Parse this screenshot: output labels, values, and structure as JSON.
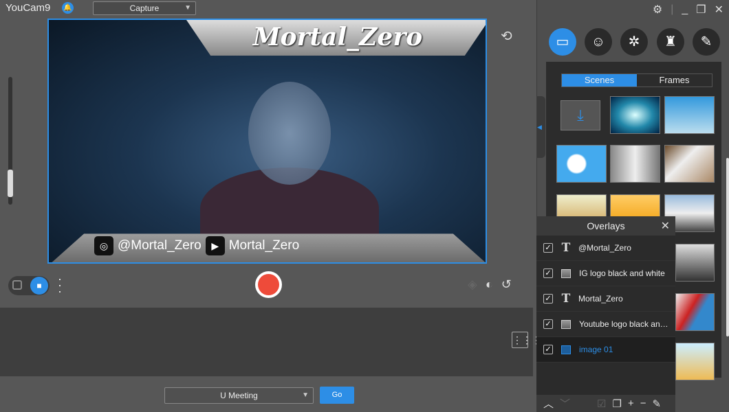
{
  "app": {
    "title": "YouCam9",
    "mode": "Capture"
  },
  "preview": {
    "banner": "Mortal_Zero",
    "instagram": "@Mortal_Zero",
    "youtube": "Mortal_Zero"
  },
  "bottom": {
    "app_select": "U Meeting",
    "go": "Go"
  },
  "colors": {
    "accent": "#2d8ee6",
    "record": "#ee4b3a"
  },
  "right": {
    "categories": [
      {
        "icon": "scene-frame-icon",
        "active": true
      },
      {
        "icon": "emoji-icon"
      },
      {
        "icon": "effects-icon"
      },
      {
        "icon": "avatar-icon"
      },
      {
        "icon": "brush-icon"
      }
    ],
    "tabs": [
      {
        "label": "Scenes",
        "active": true
      },
      {
        "label": "Frames"
      }
    ]
  },
  "overlays": {
    "title": "Overlays",
    "items": [
      {
        "type": "text",
        "label": "@Mortal_Zero",
        "checked": true
      },
      {
        "type": "image",
        "label": "IG logo black and white",
        "checked": true
      },
      {
        "type": "text",
        "label": "Mortal_Zero",
        "checked": true
      },
      {
        "type": "image",
        "label": "Youtube logo black and white",
        "checked": true
      },
      {
        "type": "image",
        "label": "image 01",
        "checked": true,
        "selected": true
      }
    ]
  }
}
